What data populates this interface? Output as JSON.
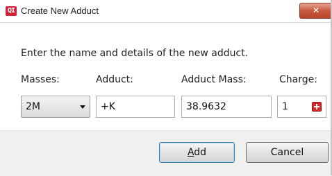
{
  "window": {
    "title": "Create New Adduct",
    "app_icon_text": "QI",
    "close_label": "✕"
  },
  "form": {
    "instructions": "Enter the name and details of the new adduct.",
    "masses_label": "Masses:",
    "adduct_label": "Adduct:",
    "adduct_mass_label": "Adduct Mass:",
    "charge_label": "Charge:",
    "masses_value": "2M",
    "adduct_value": "+K",
    "adduct_mass_value": "38.9632",
    "charge_value": "1"
  },
  "buttons": {
    "add_label_prefix": "A",
    "add_label_rest": "dd",
    "cancel_label": "Cancel"
  },
  "colors": {
    "accent": "#d2233a",
    "close_button": "#c75a3f",
    "default_button_border": "#3c7fb1"
  }
}
